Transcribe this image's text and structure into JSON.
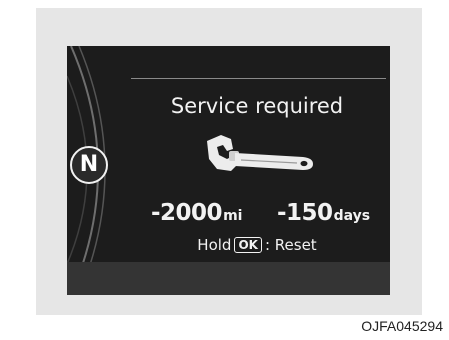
{
  "display": {
    "gear_indicator": "N",
    "title": "Service required",
    "icon": "wrench-icon",
    "distance_value": "-2000",
    "distance_unit": "mi",
    "days_value": "-150",
    "days_unit": "days",
    "hint_prefix": "Hold",
    "hint_key": "OK",
    "hint_suffix": ": Reset"
  },
  "caption": "OJFA045294",
  "colors": {
    "screen_background": "#1c1c1c",
    "frame_background": "#e6e6e6",
    "text": "#f2f2f2"
  }
}
